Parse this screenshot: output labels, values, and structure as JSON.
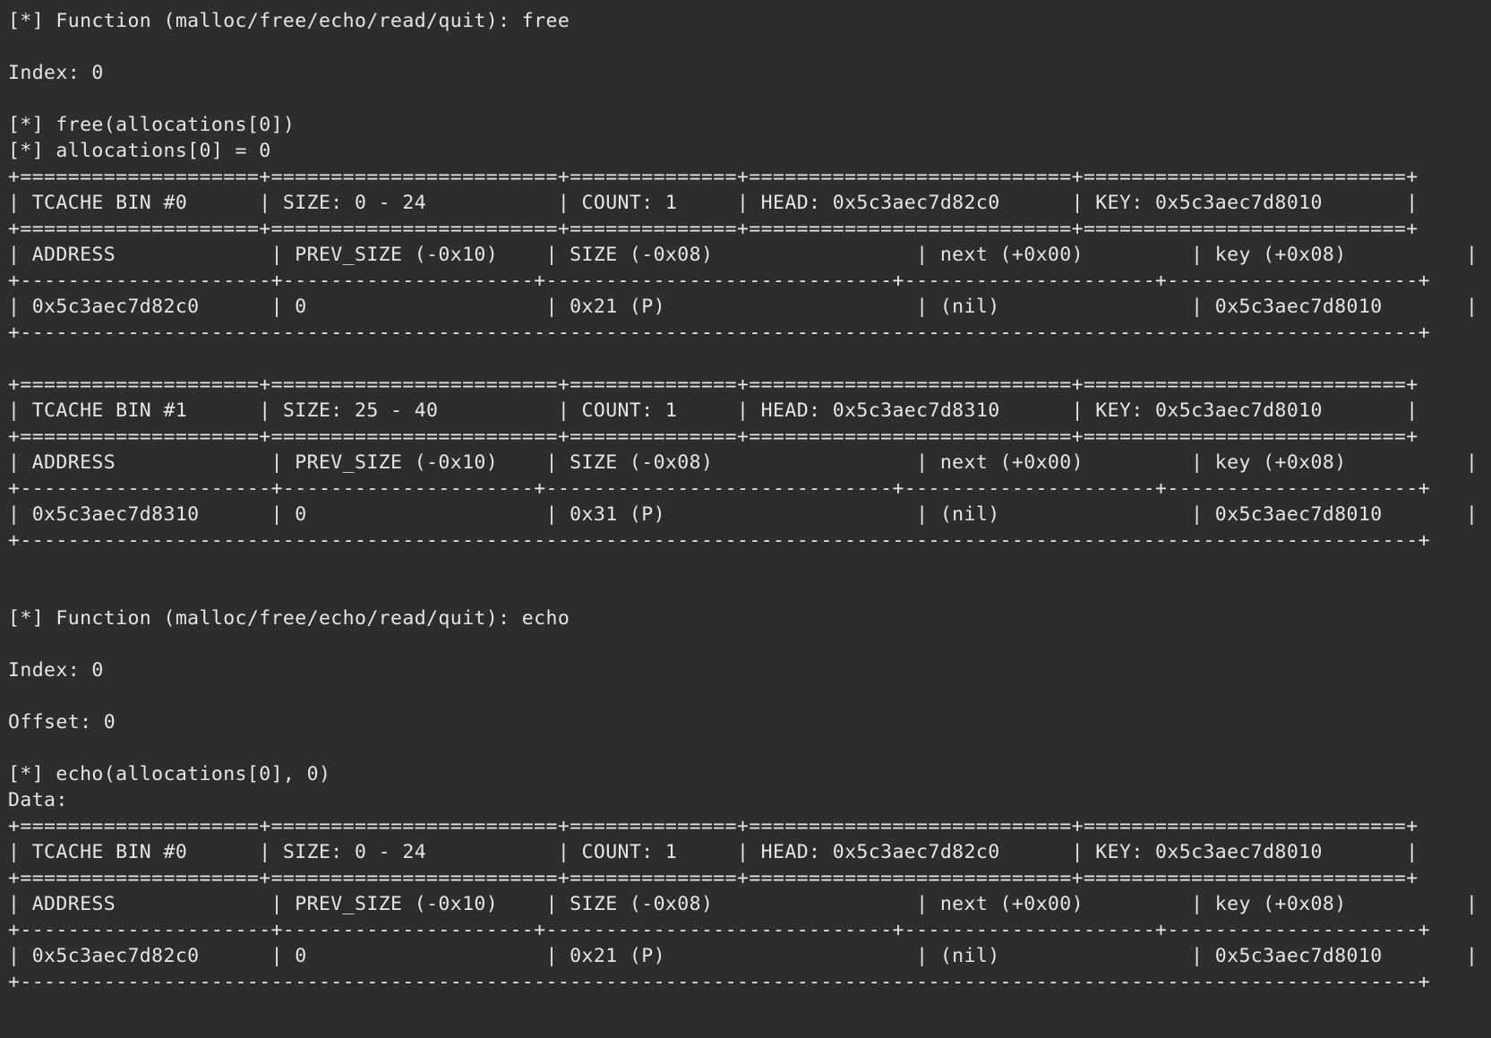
{
  "terminal": {
    "background": "#2d2d2d",
    "foreground": "#e6e6e6",
    "lines": [
      "[*] Function (malloc/free/echo/read/quit): free",
      "",
      "Index: 0",
      "",
      "[*] free(allocations[0])",
      "[*] allocations[0] = 0",
      "+====================+========================+==============+===========================+===========================+",
      "| TCACHE BIN #0      | SIZE: 0 - 24           | COUNT: 1     | HEAD: 0x5c3aec7d82c0      | KEY: 0x5c3aec7d8010       |",
      "+====================+========================+==============+===========================+===========================+",
      "| ADDRESS             | PREV_SIZE (-0x10)    | SIZE (-0x08)                 | next (+0x00)         | key (+0x08)          |",
      "+---------------------+---------------------+-----------------------------+---------------------+---------------------+",
      "| 0x5c3aec7d82c0      | 0                    | 0x21 (P)                     | (nil)                | 0x5c3aec7d8010       |",
      "+---------------------------------------------------------------------------------------------------------------------+",
      "",
      "+====================+========================+==============+===========================+===========================+",
      "| TCACHE BIN #1      | SIZE: 25 - 40          | COUNT: 1     | HEAD: 0x5c3aec7d8310      | KEY: 0x5c3aec7d8010       |",
      "+====================+========================+==============+===========================+===========================+",
      "| ADDRESS             | PREV_SIZE (-0x10)    | SIZE (-0x08)                 | next (+0x00)         | key (+0x08)          |",
      "+---------------------+---------------------+-----------------------------+---------------------+---------------------+",
      "| 0x5c3aec7d8310      | 0                    | 0x31 (P)                     | (nil)                | 0x5c3aec7d8010       |",
      "+---------------------------------------------------------------------------------------------------------------------+",
      "",
      "",
      "[*] Function (malloc/free/echo/read/quit): echo",
      "",
      "Index: 0",
      "",
      "Offset: 0",
      "",
      "[*] echo(allocations[0], 0)",
      "Data:",
      "+====================+========================+==============+===========================+===========================+",
      "| TCACHE BIN #0      | SIZE: 0 - 24           | COUNT: 1     | HEAD: 0x5c3aec7d82c0      | KEY: 0x5c3aec7d8010       |",
      "+====================+========================+==============+===========================+===========================+",
      "| ADDRESS             | PREV_SIZE (-0x10)    | SIZE (-0x08)                 | next (+0x00)         | key (+0x08)          |",
      "+---------------------+---------------------+-----------------------------+---------------------+---------------------+",
      "| 0x5c3aec7d82c0      | 0                    | 0x21 (P)                     | (nil)                | 0x5c3aec7d8010       |",
      "+---------------------------------------------------------------------------------------------------------------------+"
    ]
  }
}
